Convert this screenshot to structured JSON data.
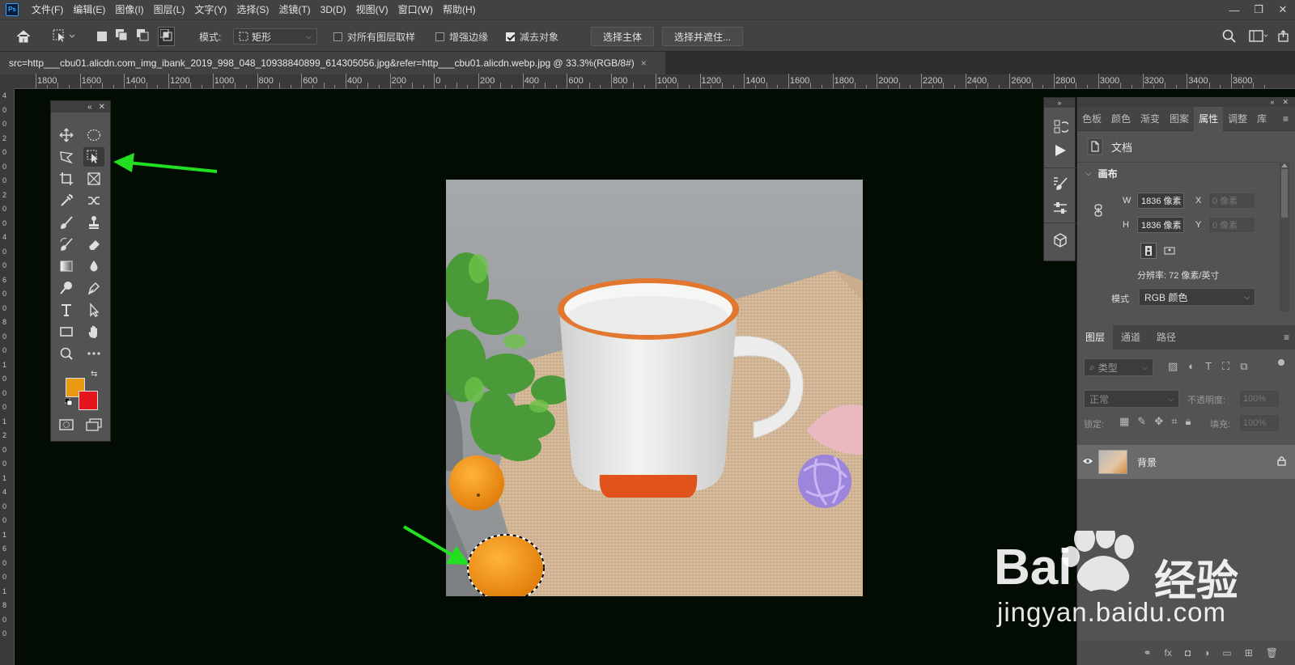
{
  "app": {
    "logo": "Ps"
  },
  "menu": [
    "文件(F)",
    "编辑(E)",
    "图像(I)",
    "图层(L)",
    "文字(Y)",
    "选择(S)",
    "滤镜(T)",
    "3D(D)",
    "视图(V)",
    "窗口(W)",
    "帮助(H)"
  ],
  "options": {
    "mode_label": "模式:",
    "mode_value": "矩形",
    "sample_all_layers": "对所有图层取样",
    "enhance_edge": "增强边缘",
    "subtract": "减去对象",
    "select_subject": "选择主体",
    "select_and_mask": "选择并遮住...",
    "sample_all_checked": false,
    "enhance_checked": false,
    "subtract_checked": true
  },
  "document": {
    "tab_title": "src=http___cbu01.alicdn.com_img_ibank_2019_998_048_10938840899_614305056.jpg&refer=http___cbu01.alicdn.webp.jpg @ 33.3%(RGB/8#)",
    "close": "×"
  },
  "ruler": {
    "h_ticks": [
      "1800",
      "1600",
      "1400",
      "1200",
      "1000",
      "800",
      "600",
      "400",
      "200",
      "0",
      "200",
      "400",
      "600",
      "800",
      "1000",
      "1200",
      "1400",
      "1600",
      "1800",
      "2000",
      "2200",
      "2400",
      "2600",
      "2800",
      "3000",
      "3200",
      "3400",
      "3600"
    ],
    "v_ticks": [
      "4",
      "0",
      "0",
      "2",
      "0",
      "0",
      "0",
      "2",
      "0",
      "0",
      "4",
      "0",
      "0",
      "6",
      "0",
      "0",
      "8",
      "0",
      "0",
      "1",
      "0",
      "0",
      "0",
      "1",
      "2",
      "0",
      "0",
      "1",
      "4",
      "0",
      "0",
      "1",
      "6",
      "0",
      "0",
      "1",
      "8",
      "0",
      "0"
    ]
  },
  "properties": {
    "tabs": [
      "色板",
      "颜色",
      "渐变",
      "图案",
      "属性",
      "调整",
      "库"
    ],
    "active_tab": "属性",
    "doc_label": "文档",
    "canvas_section": "画布",
    "w_label": "W",
    "w_value": "1836 像素",
    "h_label": "H",
    "h_value": "1836 像素",
    "x_label": "X",
    "x_value": "0 像素",
    "y_label": "Y",
    "y_value": "0 像素",
    "resolution": "分辨率: 72 像素/英寸",
    "mode_label": "模式",
    "mode_value": "RGB 颜色"
  },
  "layers": {
    "tabs": [
      "图层",
      "通道",
      "路径"
    ],
    "active_tab": "图层",
    "filter_kind": "类型",
    "blend_mode": "正常",
    "opacity_label": "不透明度:",
    "opacity_value": "100%",
    "lock_label": "锁定:",
    "fill_label": "填充:",
    "fill_value": "100%",
    "layer_name": "背景"
  },
  "colors": {
    "foreground": "#e99a12",
    "background": "#e4151d",
    "arrow": "#22e021"
  },
  "watermark": {
    "brand": "Bai",
    "brand2": "经验",
    "url": "jingyan.baidu.com"
  }
}
